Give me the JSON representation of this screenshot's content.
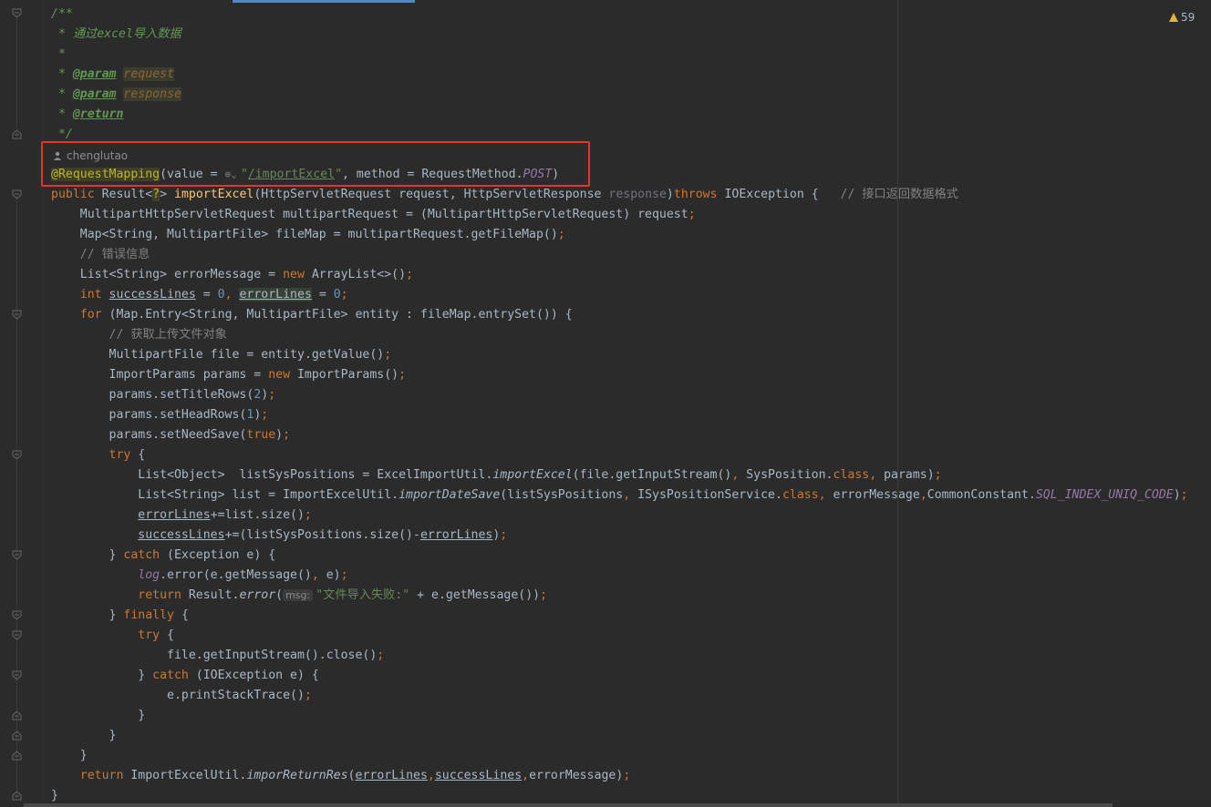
{
  "editor": {
    "inspection_count": "59",
    "author": "chenglutao",
    "colors": {
      "background": "#2b2b2b",
      "keyword": "#cc7832",
      "string": "#6a8759",
      "number": "#6897bb",
      "method": "#ffc66d",
      "comment": "#808080",
      "doc_comment": "#629755",
      "annotation": "#bbb529",
      "highlight_box": "#e8332d",
      "warning": "#e2b53a"
    }
  },
  "code": {
    "l01": {
      "t1": "/**"
    },
    "l02": {
      "t1": " * 通过excel导入数据"
    },
    "l03": {
      "t1": " *"
    },
    "l04": {
      "t1": " * ",
      "t2": "@param",
      "t3": " ",
      "t4": "request"
    },
    "l05": {
      "t1": " * ",
      "t2": "@param",
      "t3": " ",
      "t4": "response"
    },
    "l06": {
      "t1": " * ",
      "t2": "@return"
    },
    "l07": {
      "t1": " */"
    },
    "l08": {
      "t1": "@",
      "t2": "RequestMapping",
      "t3": "(value = ",
      "t4": "\"",
      "t5": "/importExcel",
      "t6": "\"",
      "t7": ", method = RequestMethod.",
      "t8": "POST",
      "t9": ")"
    },
    "l09": {
      "t1": "public ",
      "t2": "Result<",
      "t3": "?",
      "t4": "> ",
      "t5": "importExcel",
      "t6": "(HttpServletRequest request, HttpServletResponse ",
      "t7": "response",
      "t8": ")",
      "t9": "throws ",
      "t10": "IOException {   ",
      "t11": "// 接口返回数据格式"
    },
    "l10": {
      "t1": "    MultipartHttpServletRequest multipartRequest = (MultipartHttpServletRequest) request",
      "t2": ";"
    },
    "l11": {
      "t1": "    Map<String, MultipartFile> fileMap = multipartRequest.getFileMap()",
      "t2": ";"
    },
    "l12": {
      "t1": "    // 错误信息"
    },
    "l13": {
      "t1": "    List<String> errorMessage = ",
      "t2": "new ",
      "t3": "ArrayList<>()",
      "t4": ";"
    },
    "l14": {
      "t1": "    ",
      "t2": "int ",
      "t3": "successLines",
      "t4": " = ",
      "t5": "0",
      "t6": ", ",
      "t7": "errorLines",
      "t8": " = ",
      "t9": "0",
      "t10": ";"
    },
    "l15": {
      "t1": "    ",
      "t2": "for ",
      "t3": "(Map.Entry<String, MultipartFile> entity : fileMap.entrySet()) {"
    },
    "l16": {
      "t1": "        // 获取上传文件对象"
    },
    "l17": {
      "t1": "        MultipartFile file = entity.getValue()",
      "t2": ";"
    },
    "l18": {
      "t1": "        ImportParams params = ",
      "t2": "new ",
      "t3": "ImportParams()",
      "t4": ";"
    },
    "l19": {
      "t1": "        params.setTitleRows(",
      "t2": "2",
      "t3": ")",
      "t4": ";"
    },
    "l20": {
      "t1": "        params.setHeadRows(",
      "t2": "1",
      "t3": ")",
      "t4": ";"
    },
    "l21": {
      "t1": "        params.setNeedSave(",
      "t2": "true",
      "t3": ")",
      "t4": ";"
    },
    "l22": {
      "t1": "        ",
      "t2": "try ",
      "t3": "{"
    },
    "l23": {
      "t1": "            List<Object>  listSysPositions = ExcelImportUtil.",
      "t2": "importExcel",
      "t3": "(file.getInputStream()",
      "t4": ", ",
      "t5": "SysPosition.",
      "t6": "class",
      "t7": ", ",
      "t8": "params)",
      "t9": ";"
    },
    "l24": {
      "t1": "            List<String> list = ImportExcelUtil.",
      "t2": "importDateSave",
      "t3": "(listSysPositions",
      "t4": ", ",
      "t5": "ISysPositionService.",
      "t6": "class",
      "t7": ", ",
      "t8": "errorMessage",
      "t9": ",",
      "t10": "CommonConstant.",
      "t11": "SQL_INDEX_UNIQ_CODE",
      "t12": ")",
      "t13": ";"
    },
    "l25": {
      "t1": "            ",
      "t2": "errorLines",
      "t3": "+=list.size()",
      "t4": ";"
    },
    "l26": {
      "t1": "            ",
      "t2": "successLines",
      "t3": "+=(listSysPositions.size()-",
      "t4": "errorLines",
      "t5": ")",
      "t6": ";"
    },
    "l27": {
      "t1": "        } ",
      "t2": "catch ",
      "t3": "(Exception e) {"
    },
    "l28": {
      "t1": "            ",
      "t2": "log",
      "t3": ".error(e.getMessage()",
      "t4": ", ",
      "t5": "e)",
      "t6": ";"
    },
    "l29": {
      "t1": "            ",
      "t2": "return ",
      "t3": "Result.",
      "t4": "error",
      "t5": "(",
      "t6": "msg:",
      "t7": "\"文件导入失败:\"",
      "t8": " + e.getMessage())",
      "t9": ";"
    },
    "l30": {
      "t1": "        } ",
      "t2": "finally ",
      "t3": "{"
    },
    "l31": {
      "t1": "            ",
      "t2": "try ",
      "t3": "{"
    },
    "l32": {
      "t1": "                file.getInputStream().close()",
      "t2": ";"
    },
    "l33": {
      "t1": "            } ",
      "t2": "catch ",
      "t3": "(IOException e) {"
    },
    "l34": {
      "t1": "                e.printStackTrace()",
      "t2": ";"
    },
    "l35": {
      "t1": "            }"
    },
    "l36": {
      "t1": "        }"
    },
    "l37": {
      "t1": "    }"
    },
    "l38": {
      "t1": "    ",
      "t2": "return ",
      "t3": "ImportExcelUtil.",
      "t4": "imporReturnRes",
      "t5": "(",
      "t6": "errorLines",
      "t7": ",",
      "t8": "successLines",
      "t9": ",",
      "t10": "errorMessage)",
      "t11": ";"
    },
    "l39": {
      "t1": "}"
    }
  }
}
